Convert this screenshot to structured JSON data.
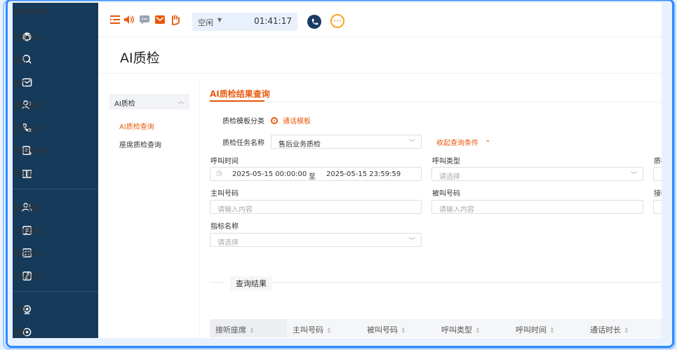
{
  "sidebar": {
    "items": [
      {
        "label": "机器人通话",
        "icon": "robot-icon"
      },
      {
        "label": "在线咨询",
        "icon": "online-consult-icon"
      },
      {
        "label": "短信",
        "icon": "sms-icon"
      },
      {
        "label": "邮件",
        "icon": "mail-icon"
      },
      {
        "label": "语音通知",
        "icon": "voice-notify-icon"
      },
      {
        "label": "外呼任务",
        "icon": "outbound-task-icon"
      },
      {
        "label": "预测式外呼",
        "icon": "predictive-call-icon"
      },
      {
        "label": "知识库",
        "icon": "knowledge-base-icon"
      },
      {
        "label": "客户管理",
        "icon": "customer-icon"
      },
      {
        "label": "工单管理",
        "icon": "ticket-icon"
      },
      {
        "label": "问卷调查",
        "icon": "survey-icon"
      },
      {
        "label": "外链对接",
        "icon": "link-icon"
      },
      {
        "label": "监控",
        "icon": "monitor-icon"
      },
      {
        "label": "质检",
        "icon": "quality-icon"
      }
    ]
  },
  "topbar": {
    "status": "空闲",
    "timer": "01:41:17"
  },
  "page": {
    "title": "AI质检"
  },
  "subnav": {
    "header": "AI质检",
    "items": [
      "AI质检查询",
      "座席质检查询"
    ]
  },
  "tab": {
    "label": "AI质检结果查询"
  },
  "form": {
    "template_category_label": "质检模板分类",
    "template_option": "通话模板",
    "task_name_label": "质检任务名称",
    "task_name_value": "售后业务质检",
    "collapse_label": "收起查询条件",
    "call_time_label": "呼叫时间",
    "start_time": "2025-05-15 00:00:00",
    "to_label": "至",
    "end_time": "2025-05-15 23:59:59",
    "call_type_label": "呼叫类型",
    "call_type_placeholder": "请选择",
    "partial_label_1": "质检",
    "caller_label": "主叫号码",
    "caller_placeholder": "请输入内容",
    "callee_label": "被叫号码",
    "callee_placeholder": "请输入内容",
    "partial_label_2": "接听",
    "metric_label": "指标名称",
    "metric_placeholder": "请选择"
  },
  "results": {
    "title": "查询结果",
    "columns": [
      "接听座席",
      "主叫号码",
      "被叫号码",
      "呼叫类型",
      "呼叫时间",
      "通话时长"
    ]
  },
  "colors": {
    "sidebar_bg": "#163a5a",
    "accent": "#e8590c",
    "frame": "#2f8bff"
  }
}
